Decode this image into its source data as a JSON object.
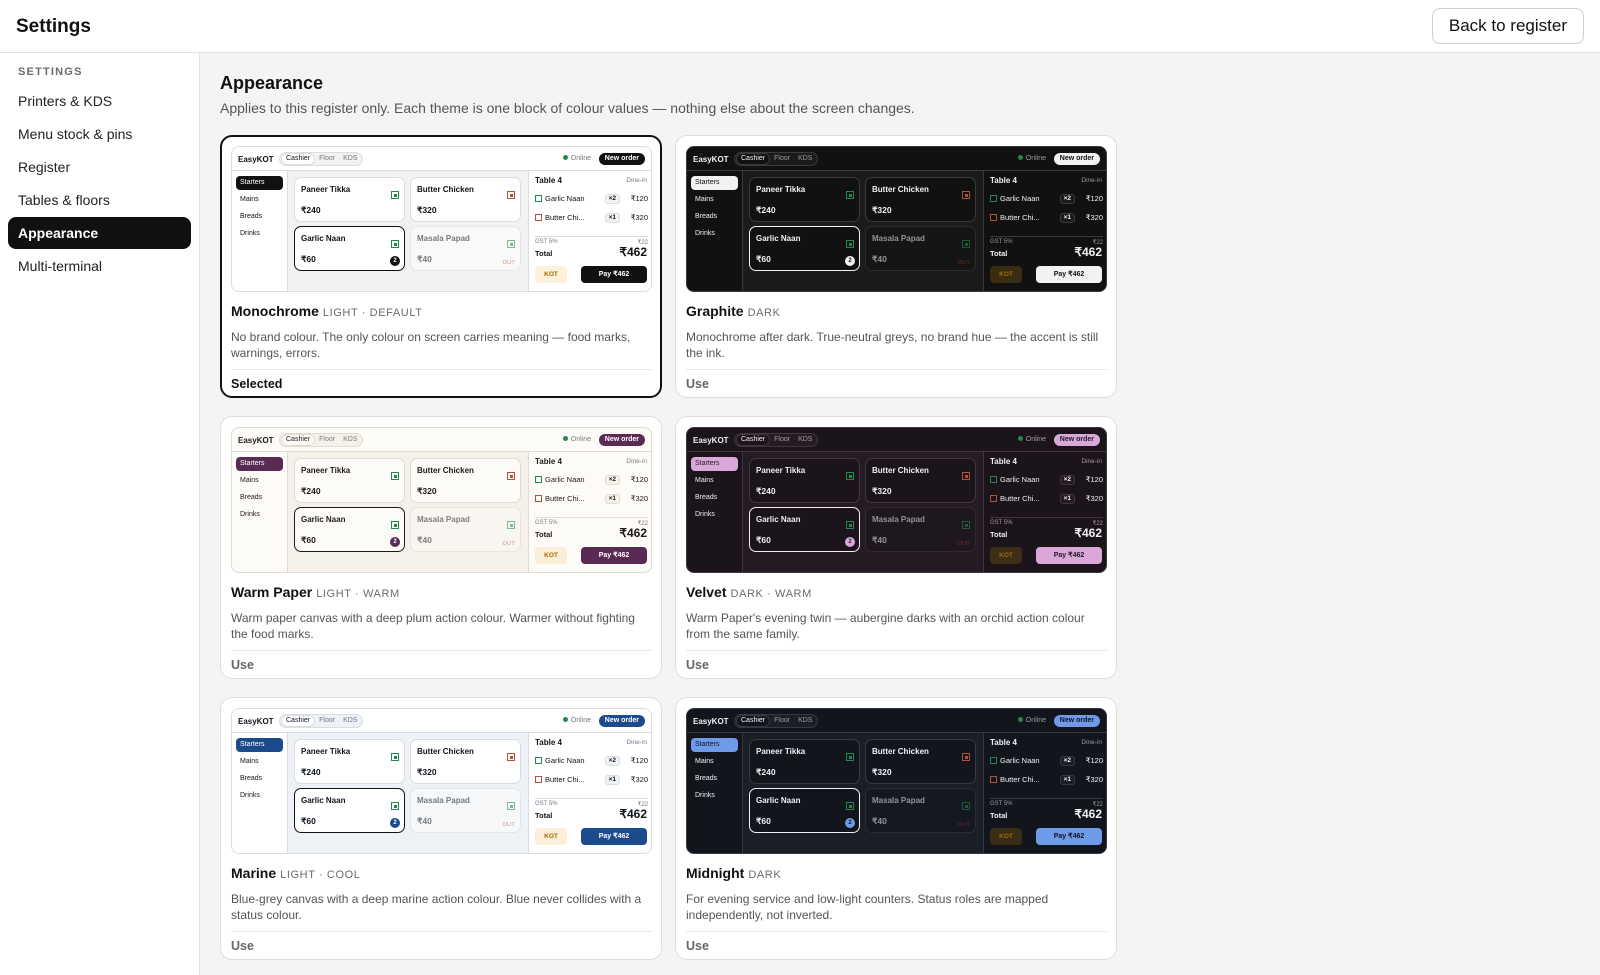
{
  "header": {
    "title": "Settings",
    "back_label": "Back to register"
  },
  "sidebar": {
    "heading": "SETTINGS",
    "items": [
      {
        "label": "Printers & KDS",
        "active": false
      },
      {
        "label": "Menu stock & pins",
        "active": false
      },
      {
        "label": "Register",
        "active": false
      },
      {
        "label": "Tables & floors",
        "active": false
      },
      {
        "label": "Appearance",
        "active": true
      },
      {
        "label": "Multi-terminal",
        "active": false
      }
    ]
  },
  "appearance": {
    "title": "Appearance",
    "description": "Applies to this register only. Each theme is one block of colour values — nothing else about the screen changes."
  },
  "preview": {
    "brand": "EasyKOT",
    "tabs": [
      "Cashier",
      "Floor",
      "KDS"
    ],
    "online": "Online",
    "new_order": "New order",
    "categories": [
      "Starters",
      "Mains",
      "Breads",
      "Drinks"
    ],
    "items": [
      {
        "name": "Paneer Tikka",
        "price": "₹240",
        "veg": true
      },
      {
        "name": "Butter Chicken",
        "price": "₹320",
        "veg": false
      },
      {
        "name": "Garlic Naan",
        "price": "₹60",
        "veg": true,
        "badge": "2"
      },
      {
        "name": "Masala Papad",
        "price": "₹40",
        "veg": true,
        "out": "OUT"
      }
    ],
    "table": "Table 4",
    "dine": "Dine-in",
    "lines": [
      {
        "name": "Garlic Naan",
        "qty": "×2",
        "price": "₹120",
        "veg": true
      },
      {
        "name": "Butter Chi...",
        "qty": "×1",
        "price": "₹320",
        "veg": false
      }
    ],
    "gst_label": "GST 5%",
    "gst_value": "₹22",
    "total_label": "Total",
    "total_value": "₹462",
    "kot": "KOT",
    "pay": "Pay ₹462"
  },
  "themes": [
    {
      "name": "Monochrome",
      "tag": "LIGHT · DEFAULT",
      "desc": "No brand colour. The only colour on screen carries meaning — food marks, warnings, errors.",
      "action": "Selected",
      "selected": true,
      "colors": {
        "canvas": "#f2f2f2",
        "panel": "#ffffff",
        "text": "#111111",
        "muted": "#777777",
        "line": "#dddddd",
        "accent": "#111111",
        "on_accent": "#ffffff",
        "kot": "#fdf1dc"
      }
    },
    {
      "name": "Graphite",
      "tag": "DARK",
      "desc": "Monochrome after dark. True-neutral greys, no brand hue — the accent is still the ink.",
      "action": "Use",
      "selected": false,
      "colors": {
        "canvas": "#1b1b1b",
        "panel": "#111111",
        "text": "#f2f2f2",
        "muted": "#9a9a9a",
        "line": "#3a3a3a",
        "accent": "#f2f2f2",
        "on_accent": "#111111",
        "kot": "#3a2c12"
      }
    },
    {
      "name": "Warm Paper",
      "tag": "LIGHT · WARM",
      "desc": "Warm paper canvas with a deep plum action colour. Warmer without fighting the food marks.",
      "action": "Use",
      "selected": false,
      "colors": {
        "canvas": "#f5f1ea",
        "panel": "#fdfbf7",
        "text": "#1f1a17",
        "muted": "#857a70",
        "line": "#e2dbd0",
        "accent": "#5a2a54",
        "on_accent": "#ffffff",
        "kot": "#fbeed6"
      }
    },
    {
      "name": "Velvet",
      "tag": "DARK · WARM",
      "desc": "Warm Paper's evening twin — aubergine darks with an orchid action colour from the same family.",
      "action": "Use",
      "selected": false,
      "colors": {
        "canvas": "#241b24",
        "panel": "#1b141b",
        "text": "#f3ecf2",
        "muted": "#a79aa5",
        "line": "#413541",
        "accent": "#d9a8d8",
        "on_accent": "#231a23",
        "kot": "#3d2e18"
      }
    },
    {
      "name": "Marine",
      "tag": "LIGHT · COOL",
      "desc": "Blue-grey canvas with a deep marine action colour. Blue never collides with a status colour.",
      "action": "Use",
      "selected": false,
      "colors": {
        "canvas": "#eef1f5",
        "panel": "#ffffff",
        "text": "#10151c",
        "muted": "#6f7885",
        "line": "#d8dde5",
        "accent": "#1c4b8c",
        "on_accent": "#ffffff",
        "kot": "#fcefd9"
      }
    },
    {
      "name": "Midnight",
      "tag": "DARK",
      "desc": "For evening service and low-light counters. Status roles are mapped independently, not inverted.",
      "action": "Use",
      "selected": false,
      "colors": {
        "canvas": "#1a1e25",
        "panel": "#12151b",
        "text": "#eef1f6",
        "muted": "#959cab",
        "line": "#343a45",
        "accent": "#6f9ae8",
        "on_accent": "#0f1420",
        "kot": "#3a2d15"
      }
    }
  ]
}
